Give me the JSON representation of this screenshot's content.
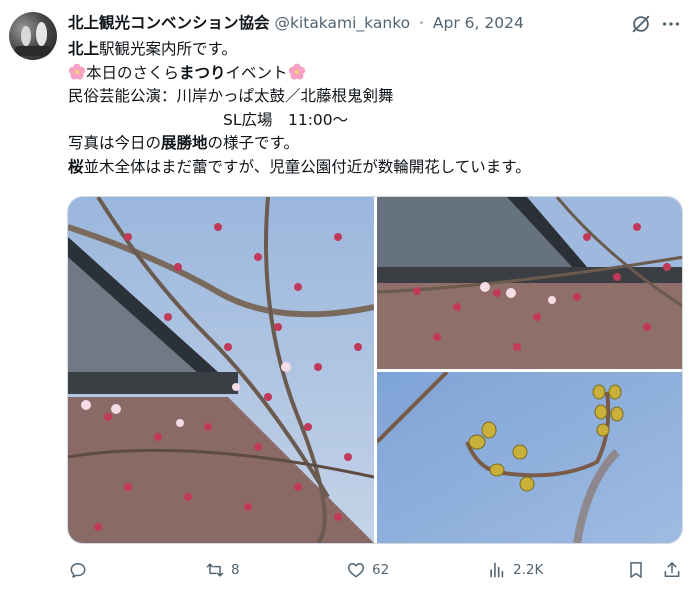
{
  "post": {
    "author_name": "北上観光コンベンション協会",
    "handle": "@kitakami_kanko",
    "separator": "·",
    "date": "Apr 6, 2024",
    "lines": [
      {
        "segments": [
          {
            "t": "北上",
            "b": true
          },
          {
            "t": "駅観光案内所です。",
            "b": false
          }
        ]
      },
      {
        "emoji": true,
        "segments": [
          {
            "t": "本日のさくら",
            "b": false
          },
          {
            "t": "まつり",
            "b": true
          },
          {
            "t": "イベント",
            "b": false
          }
        ]
      },
      {
        "segments": [
          {
            "t": "民俗芸能公演：川岸かっぱ太鼓／北藤根鬼剣舞",
            "b": false
          }
        ]
      },
      {
        "segments": [
          {
            "t": "　　　　　　　　　　SL広場　11:00〜",
            "b": false
          }
        ]
      },
      {
        "segments": [
          {
            "t": "写真は今日の",
            "b": false
          },
          {
            "t": "展勝地",
            "b": true
          },
          {
            "t": "の様子です。",
            "b": false
          }
        ]
      },
      {
        "segments": [
          {
            "t": "桜",
            "b": true
          },
          {
            "t": "並木全体はまだ蕾ですが、児童公園付近が数輪開花しています。",
            "b": false
          }
        ]
      }
    ]
  },
  "actions": {
    "reply_count": "",
    "retweet_count": "8",
    "like_count": "62",
    "view_count": "2.2K"
  },
  "icons": {
    "grok": "grok-icon",
    "more": "more-icon",
    "reply": "reply-icon",
    "retweet": "retweet-icon",
    "like": "heart-icon",
    "views": "views-icon",
    "bookmark": "bookmark-icon",
    "share": "share-icon",
    "blossom": "cherry-blossom-emoji"
  },
  "colors": {
    "text": "#0f1419",
    "muted": "#536471",
    "blossom": "#f7a1c4",
    "sky": "#7fa7d8"
  }
}
